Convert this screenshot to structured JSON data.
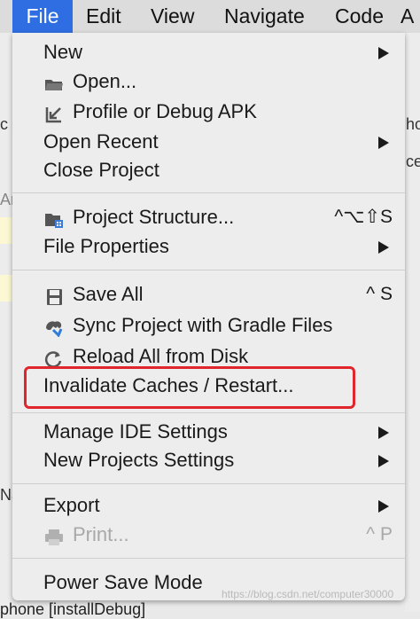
{
  "menubar": {
    "items": [
      "File",
      "Edit",
      "View",
      "Navigate",
      "Code",
      "A"
    ]
  },
  "background": {
    "left_fragments": [
      "c",
      "Ar",
      "Na"
    ],
    "right_fragments": [
      "ho",
      "ce"
    ],
    "bottom_text": "phone [installDebug]"
  },
  "menu": {
    "new": {
      "label": "New"
    },
    "open": {
      "label": "Open...",
      "icon": "folder-icon"
    },
    "profile_debug": {
      "label": "Profile or Debug APK",
      "icon": "import-arrow-icon"
    },
    "open_recent": {
      "label": "Open Recent"
    },
    "close_project": {
      "label": "Close Project"
    },
    "project_structure": {
      "label": "Project Structure...",
      "icon": "project-structure-icon",
      "shortcut": "^⌥⇧S"
    },
    "file_properties": {
      "label": "File Properties"
    },
    "save_all": {
      "label": "Save All",
      "icon": "save-icon",
      "shortcut": "^ S"
    },
    "sync_gradle": {
      "label": "Sync Project with Gradle Files",
      "icon": "gradle-sync-icon"
    },
    "reload_disk": {
      "label": "Reload All from Disk",
      "icon": "reload-icon"
    },
    "invalidate_caches": {
      "label": "Invalidate Caches / Restart..."
    },
    "manage_ide": {
      "label": "Manage IDE Settings"
    },
    "new_projects_settings": {
      "label": "New Projects Settings"
    },
    "export": {
      "label": "Export"
    },
    "print": {
      "label": "Print...",
      "icon": "printer-icon",
      "shortcut": "^ P",
      "disabled": true
    },
    "power_save": {
      "label": "Power Save Mode"
    }
  },
  "watermark": "https://blog.csdn.net/computer30000",
  "colors": {
    "menu_bg": "#ededed",
    "file_selected": "#2f6ee2",
    "highlight": "#e0262b"
  }
}
